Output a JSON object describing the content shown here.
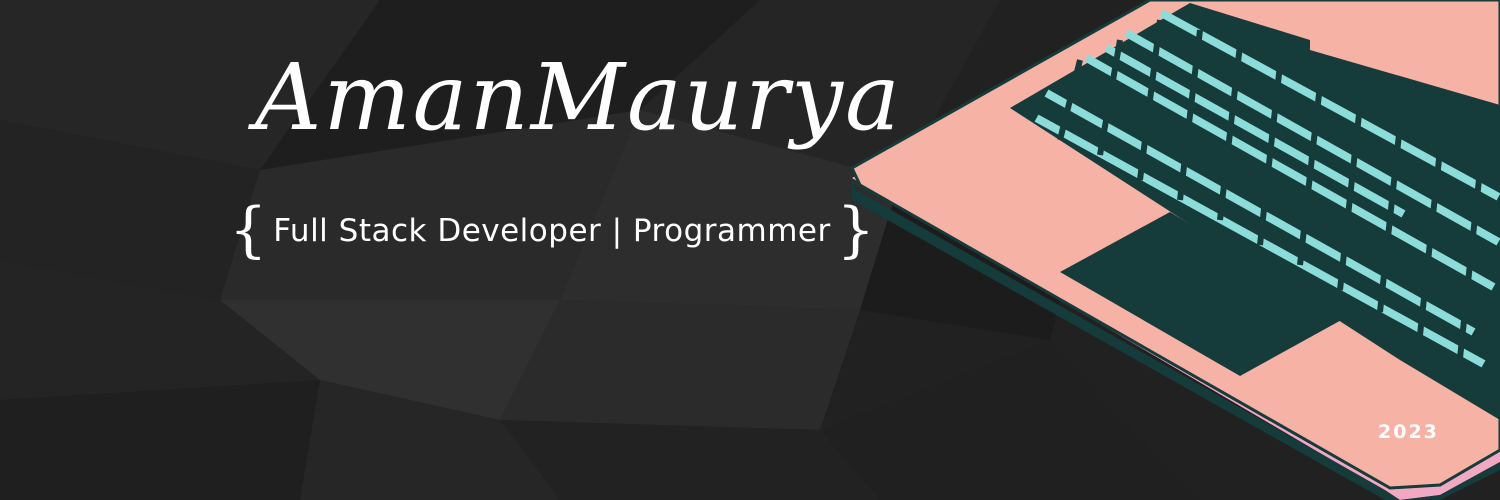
{
  "banner": {
    "name": "AmanMaurya",
    "open_brace": "{",
    "subtitle": "Full Stack Developer | Programmer",
    "close_brace": "}",
    "year": "2023"
  },
  "colors": {
    "background": "#222222",
    "laptop_body": "#f7b2a6",
    "laptop_edge": "#f2a7c3",
    "keyboard_dark": "#163b3b",
    "keys": "#8cdcd9",
    "screen": "#92dcdc",
    "text": "#ffffff"
  },
  "graphics": {
    "laptop_icon": "laptop-illustration",
    "background_pattern": "low-poly-dark"
  }
}
